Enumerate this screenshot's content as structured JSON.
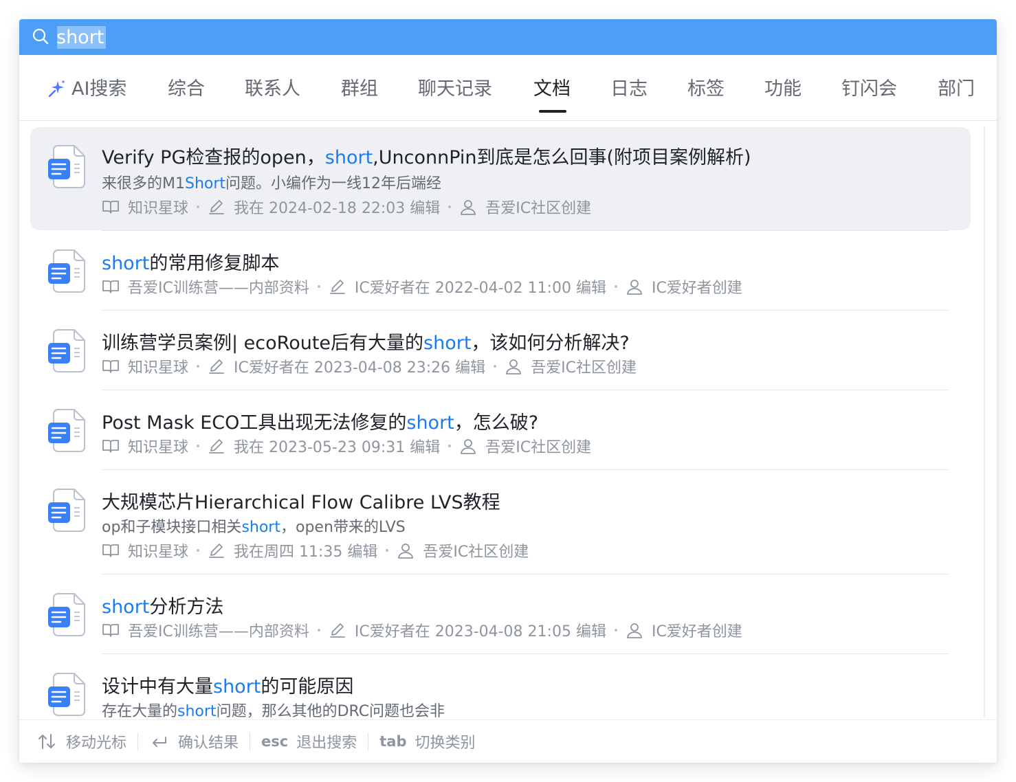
{
  "search": {
    "query": "short",
    "placeholder": ""
  },
  "tabs": [
    {
      "label": "AI搜索",
      "icon": "ai-sparkle-icon",
      "active": false
    },
    {
      "label": "综合",
      "active": false
    },
    {
      "label": "联系人",
      "active": false
    },
    {
      "label": "群组",
      "active": false
    },
    {
      "label": "聊天记录",
      "active": false
    },
    {
      "label": "文档",
      "active": true
    },
    {
      "label": "日志",
      "active": false
    },
    {
      "label": "标签",
      "active": false
    },
    {
      "label": "功能",
      "active": false
    },
    {
      "label": "钉闪会",
      "active": false
    },
    {
      "label": "部门",
      "active": false
    }
  ],
  "colors": {
    "search_bar": "#4d9ef7",
    "highlight": "#1a7cf1",
    "hover_row": "#eff0f4"
  },
  "results": [
    {
      "title": [
        "Verify PG检查报的open，",
        "short",
        ",UnconnPin到底是怎么回事(附项目案例解析)"
      ],
      "snippet": [
        "来很多的M1",
        "Short",
        "问题。小编作为一线12年后端经"
      ],
      "space": "知识星球",
      "edited": "我在 2024-02-18 22:03 编辑",
      "creator": "吾爱IC社区创建"
    },
    {
      "title": [
        "",
        "short",
        "的常用修复脚本"
      ],
      "snippet": null,
      "space": "吾爱IC训练营——内部资料",
      "edited": "IC爱好者在 2022-04-02 11:00 编辑",
      "creator": "IC爱好者创建"
    },
    {
      "title": [
        "训练营学员案例| ecoRoute后有大量的",
        "short",
        "，该如何分析解决?"
      ],
      "snippet": null,
      "space": "知识星球",
      "edited": "IC爱好者在 2023-04-08 23:26 编辑",
      "creator": "吾爱IC社区创建"
    },
    {
      "title": [
        "Post Mask ECO工具出现无法修复的",
        "short",
        "，怎么破?"
      ],
      "snippet": null,
      "space": "知识星球",
      "edited": "我在 2023-05-23 09:31 编辑",
      "creator": "吾爱IC社区创建"
    },
    {
      "title": [
        "大规模芯片Hierarchical Flow Calibre LVS教程",
        "",
        ""
      ],
      "snippet": [
        "op和子模块接口相关",
        "short",
        "，open带来的LVS"
      ],
      "space": "知识星球",
      "edited": "我在周四 11:35 编辑",
      "creator": "吾爱IC社区创建"
    },
    {
      "title": [
        "",
        "short",
        "分析方法"
      ],
      "snippet": null,
      "space": "吾爱IC训练营——内部资料",
      "edited": "IC爱好者在 2023-04-08 21:05 编辑",
      "creator": "IC爱好者创建"
    },
    {
      "title": [
        "设计中有大量",
        "short",
        "的可能原因"
      ],
      "snippet": [
        "存在大量的",
        "short",
        "问题，那么其他的DRC问题也会非"
      ],
      "space": null,
      "edited": null,
      "creator": null
    }
  ],
  "footer": [
    {
      "key": "",
      "icon": "up-down-arrows-icon",
      "label": "移动光标"
    },
    {
      "key": "",
      "icon": "enter-return-icon",
      "label": "确认结果"
    },
    {
      "key": "esc",
      "icon": null,
      "label": "退出搜索"
    },
    {
      "key": "tab",
      "icon": null,
      "label": "切换类别"
    }
  ]
}
